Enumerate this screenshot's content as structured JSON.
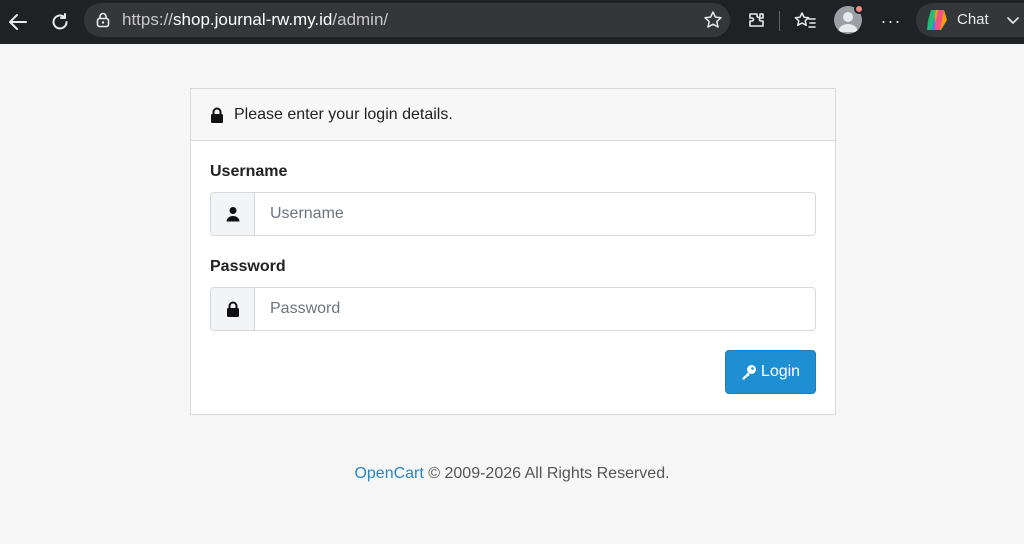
{
  "browser": {
    "url_scheme": "https://",
    "url_host": "shop.journal-rw.my.id",
    "url_path": "/admin/",
    "chat_label": "Chat",
    "more_label": "···"
  },
  "login": {
    "header_text": "Please enter your login details.",
    "username_label": "Username",
    "username_placeholder": "Username",
    "username_value": "",
    "password_label": "Password",
    "password_placeholder": "Password",
    "password_value": "",
    "login_button_label": "Login"
  },
  "footer": {
    "brand_link": "OpenCart",
    "copyright": " © 2009-2026 All Rights Reserved."
  },
  "colors": {
    "primary": "#1f8fd4",
    "link": "#2a86c8",
    "page_bg": "#f6f6f6",
    "chrome_bg": "#202124"
  }
}
